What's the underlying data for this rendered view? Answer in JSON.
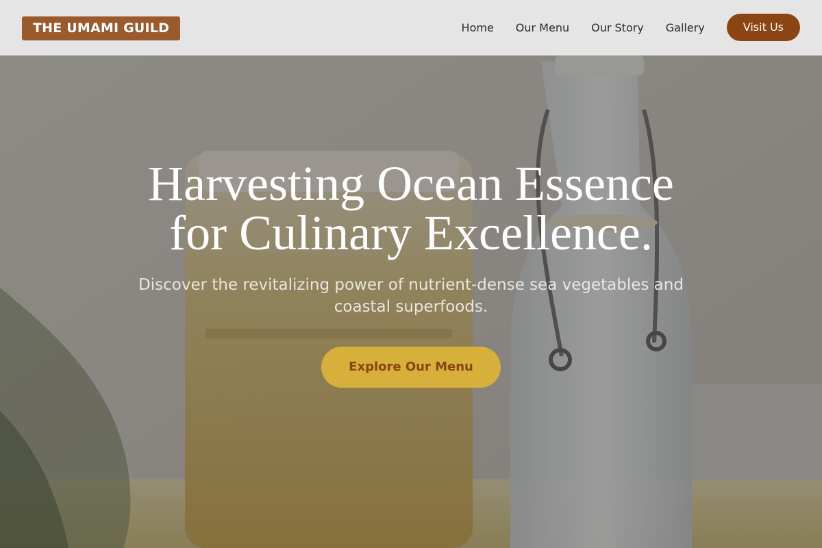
{
  "header": {
    "logo_text": "THE UMAMI GUILD",
    "nav": {
      "home": "Home",
      "menu": "Our Menu",
      "story": "Our Story",
      "gallery": "Gallery"
    },
    "cta_label": "Visit Us"
  },
  "hero": {
    "title_line1": "Harvesting Ocean Essence",
    "title_line2": "for Culinary Excellence.",
    "subtitle": "Discover the revitalizing power of nutrient-dense sea vegetables and coastal superfoods.",
    "cta_label": "Explore Our Menu",
    "background_image": "glass jars and swing-top bottle on a kitchen counter"
  },
  "colors": {
    "header_bg": "#e5e5e5",
    "logo_bg": "#9b5a2c",
    "visit_button_bg": "#8b4513",
    "cta_bg": "#d6b03a",
    "cta_text": "#8b4513"
  }
}
